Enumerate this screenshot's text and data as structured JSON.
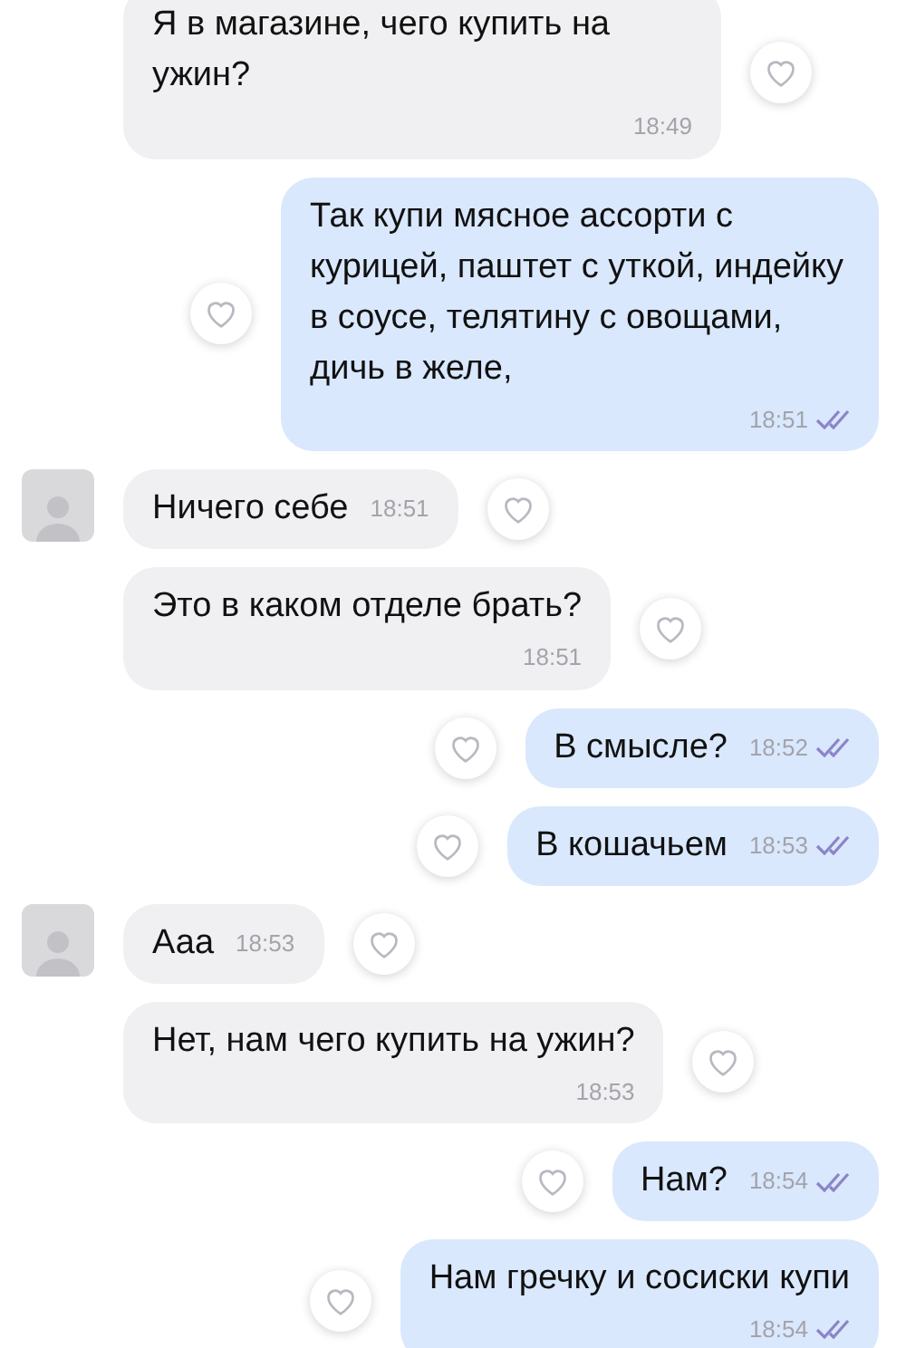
{
  "messages": [
    {
      "kind": "incoming",
      "avatar": false,
      "time_inline": false,
      "text": "Я в магазине, чего купить на ужин?",
      "time": "18:49"
    },
    {
      "kind": "outgoing",
      "read": true,
      "time_inline": false,
      "text": "Так купи мясное ассорти с курицей, паштет с уткой, индейку в соусе, телятину с овощами, дичь в желе,",
      "time": "18:51"
    },
    {
      "kind": "incoming",
      "avatar": true,
      "time_inline": true,
      "text": "Ничего себе",
      "time": "18:51"
    },
    {
      "kind": "incoming",
      "avatar": false,
      "time_inline": false,
      "text": "Это в каком отделе брать?",
      "time": "18:51"
    },
    {
      "kind": "outgoing",
      "read": true,
      "time_inline": true,
      "text": "В смысле?",
      "time": "18:52"
    },
    {
      "kind": "outgoing",
      "read": true,
      "time_inline": true,
      "text": "В кошачьем",
      "time": "18:53"
    },
    {
      "kind": "incoming",
      "avatar": true,
      "time_inline": true,
      "text": "Ааа",
      "time": "18:53"
    },
    {
      "kind": "incoming",
      "avatar": false,
      "time_inline": false,
      "text": "Нет, нам чего купить на ужин?",
      "time": "18:53"
    },
    {
      "kind": "outgoing",
      "read": true,
      "time_inline": true,
      "text": "Нам?",
      "time": "18:54"
    },
    {
      "kind": "outgoing",
      "read": true,
      "time_inline": false,
      "text": "Нам гречку и сосиски купи",
      "time": "18:54"
    }
  ]
}
